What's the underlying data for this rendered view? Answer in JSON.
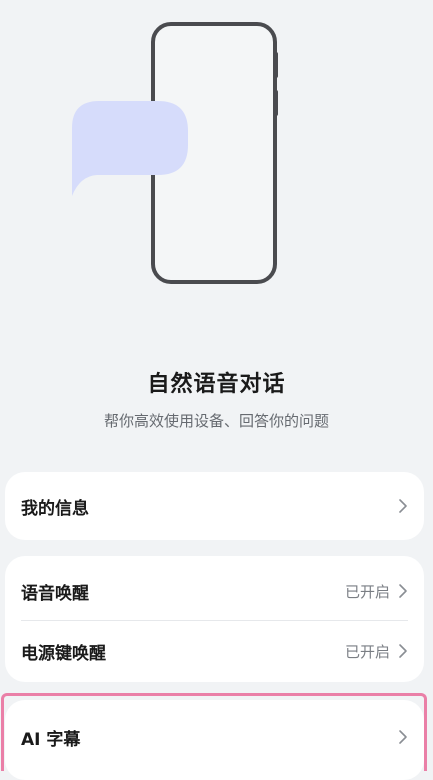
{
  "hero": {
    "title": "自然语音对话",
    "subtitle": "帮你高效使用设备、回答你的问题"
  },
  "menu": {
    "my_info": {
      "label": "我的信息"
    },
    "voice_wakeup": {
      "label": "语音唤醒",
      "status": "已开启"
    },
    "power_key_wakeup": {
      "label": "电源键唤醒",
      "status": "已开启"
    },
    "ai_subtitles": {
      "label": "AI 字幕"
    }
  },
  "icons": {
    "chevron": "chevron-right-icon",
    "illustration": "phone-chat-bubble-illustration"
  },
  "colors": {
    "background": "#f1f3f5",
    "card": "#ffffff",
    "bubble": "#d6dcfb",
    "phone_frame": "#4a4b4f",
    "highlight": "#ea7fa7"
  }
}
